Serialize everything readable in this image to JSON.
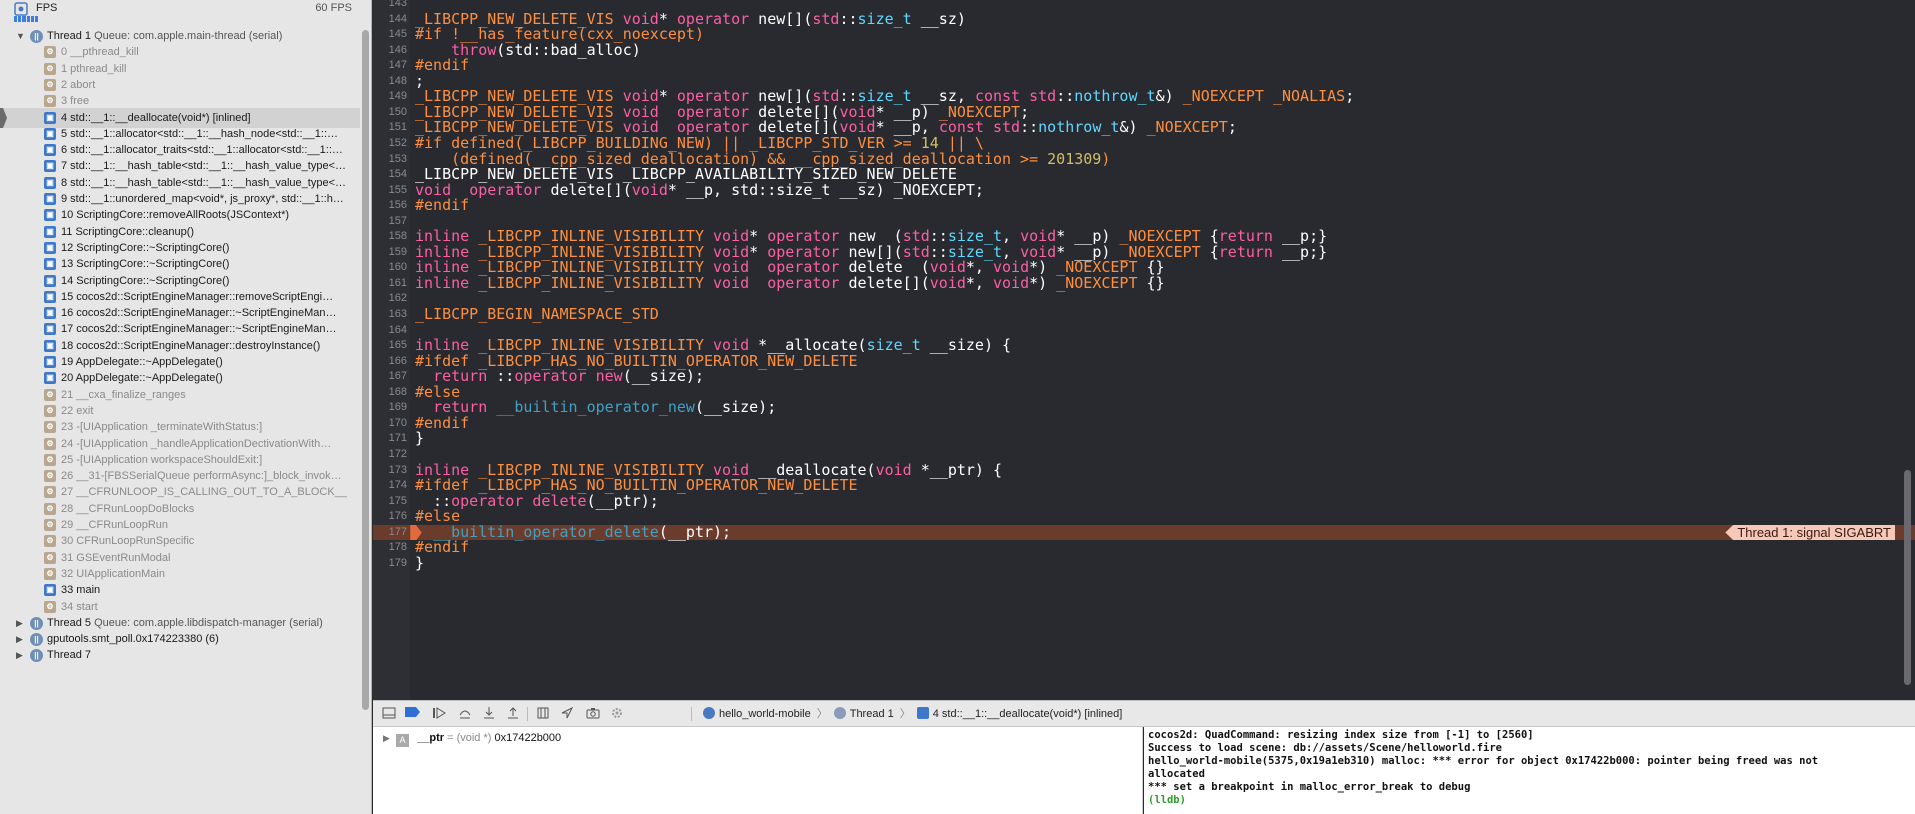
{
  "navigator": {
    "fps_label": "FPS",
    "fps_value": "60 FPS",
    "threads": [
      {
        "label": "Thread 1",
        "queue": "Queue: com.apple.main-thread (serial)"
      },
      {
        "label": "Thread 5",
        "queue": "Queue: com.apple.libdispatch-manager (serial)"
      },
      {
        "label": "gputools.smt_poll.0x174223380 (6)",
        "queue": ""
      },
      {
        "label": "Thread 7",
        "queue": ""
      }
    ],
    "frames": [
      {
        "text": "0 __pthread_kill",
        "user": false
      },
      {
        "text": "1 pthread_kill",
        "user": false
      },
      {
        "text": "2 abort",
        "user": false
      },
      {
        "text": "3 free",
        "user": false
      },
      {
        "text": "4 std::__1::__deallocate(void*) [inlined]",
        "user": true
      },
      {
        "text": "5 std::__1::allocator<std::__1::__hash_node<std::__1::…",
        "user": true
      },
      {
        "text": "6 std::__1::allocator_traits<std::__1::allocator<std::__1::…",
        "user": true
      },
      {
        "text": "7 std::__1::__hash_table<std::__1::__hash_value_type<v…",
        "user": true
      },
      {
        "text": "8 std::__1::__hash_table<std::__1::__hash_value_type<v…",
        "user": true
      },
      {
        "text": "9 std::__1::unordered_map<void*, js_proxy*, std::__1::h…",
        "user": true
      },
      {
        "text": "10 ScriptingCore::removeAllRoots(JSContext*)",
        "user": true
      },
      {
        "text": "11 ScriptingCore::cleanup()",
        "user": true
      },
      {
        "text": "12 ScriptingCore::~ScriptingCore()",
        "user": true
      },
      {
        "text": "13 ScriptingCore::~ScriptingCore()",
        "user": true
      },
      {
        "text": "14 ScriptingCore::~ScriptingCore()",
        "user": true
      },
      {
        "text": "15 cocos2d::ScriptEngineManager::removeScriptEngi…",
        "user": true
      },
      {
        "text": "16 cocos2d::ScriptEngineManager::~ScriptEngineMan…",
        "user": true
      },
      {
        "text": "17 cocos2d::ScriptEngineManager::~ScriptEngineMan…",
        "user": true
      },
      {
        "text": "18 cocos2d::ScriptEngineManager::destroyInstance()",
        "user": true
      },
      {
        "text": "19 AppDelegate::~AppDelegate()",
        "user": true
      },
      {
        "text": "20 AppDelegate::~AppDelegate()",
        "user": true
      },
      {
        "text": "21 __cxa_finalize_ranges",
        "user": false
      },
      {
        "text": "22 exit",
        "user": false
      },
      {
        "text": "23 -[UIApplication _terminateWithStatus:]",
        "user": false
      },
      {
        "text": "24 -[UIApplication _handleApplicationDectivationWith…",
        "user": false
      },
      {
        "text": "25 -[UIApplication workspaceShouldExit:]",
        "user": false
      },
      {
        "text": "26 __31-[FBSSerialQueue performAsync:]_block_invok…",
        "user": false
      },
      {
        "text": "27 __CFRUNLOOP_IS_CALLING_OUT_TO_A_BLOCK__",
        "user": false
      },
      {
        "text": "28 __CFRunLoopDoBlocks",
        "user": false
      },
      {
        "text": "29 __CFRunLoopRun",
        "user": false
      },
      {
        "text": "30 CFRunLoopRunSpecific",
        "user": false
      },
      {
        "text": "31 GSEventRunModal",
        "user": false
      },
      {
        "text": "32 UIApplicationMain",
        "user": false
      },
      {
        "text": "33 main",
        "user": true
      },
      {
        "text": "34 start",
        "user": false
      }
    ]
  },
  "editor": {
    "lines": [
      {
        "n": "143",
        "html": ""
      },
      {
        "n": "144",
        "html": "<span class='mc'>_LIBCPP_NEW_DELETE_VIS</span> <span class='kw'>void</span>* <span class='kw'>operator</span> new[](<span class='kw'>std</span>::<span class='ty'>size_t</span> __sz)"
      },
      {
        "n": "145",
        "html": "<span class='pp'>#if !__has_feature(cxx_noexcept)</span>"
      },
      {
        "n": "146",
        "html": "    <span class='kw'>throw</span>(std::bad_alloc)"
      },
      {
        "n": "147",
        "html": "<span class='pp'>#endif</span>"
      },
      {
        "n": "148",
        "html": ";"
      },
      {
        "n": "149",
        "html": "<span class='mc'>_LIBCPP_NEW_DELETE_VIS</span> <span class='kw'>void</span>* <span class='kw'>operator</span> new[](<span class='kw'>std</span>::<span class='ty'>size_t</span> __sz, <span class='kw'>const</span> <span class='kw'>std</span>::<span class='ty'>nothrow_t</span>&amp;) <span class='mc'>_NOEXCEPT</span> <span class='mc'>_NOALIAS</span>;"
      },
      {
        "n": "150",
        "html": "<span class='mc'>_LIBCPP_NEW_DELETE_VIS</span> <span class='kw'>void</span>  <span class='kw'>operator</span> delete[](<span class='kw'>void</span>* __p) <span class='mc'>_NOEXCEPT</span>;"
      },
      {
        "n": "151",
        "html": "<span class='mc'>_LIBCPP_NEW_DELETE_VIS</span> <span class='kw'>void</span>  <span class='kw'>operator</span> delete[](<span class='kw'>void</span>* __p, <span class='kw'>const</span> <span class='kw'>std</span>::<span class='ty'>nothrow_t</span>&amp;) <span class='mc'>_NOEXCEPT</span>;"
      },
      {
        "n": "152",
        "html": "<span class='pp'>#if defined(_LIBCPP_BUILDING_NEW) || _LIBCPP_STD_VER &gt;= </span><span class='num'>14</span><span class='pp'> || \\</span>"
      },
      {
        "n": "153",
        "html": "<span class='pp'>    (defined(__cpp_sized_deallocation) &amp;&amp; __cpp_sized_deallocation &gt;= </span><span class='num'>201309</span><span class='pp'>)</span>"
      },
      {
        "n": "154",
        "html": "_LIBCPP_NEW_DELETE_VIS _LIBCPP_AVAILABILITY_SIZED_NEW_DELETE"
      },
      {
        "n": "155",
        "html": "<span class='kw'>void</span>  <span class='kw'>operator</span> delete[](<span class='kw'>void</span>* __p, std::size_t __sz) _NOEXCEPT;"
      },
      {
        "n": "156",
        "html": "<span class='pp'>#endif</span>"
      },
      {
        "n": "157",
        "html": ""
      },
      {
        "n": "158",
        "html": "<span class='kw'>inline</span> <span class='mc'>_LIBCPP_INLINE_VISIBILITY</span> <span class='kw'>void</span>* <span class='kw'>operator</span> new  (<span class='kw'>std</span>::<span class='ty'>size_t</span>, <span class='kw'>void</span>* __p) <span class='mc'>_NOEXCEPT</span> {<span class='kw'>return</span> __p;}"
      },
      {
        "n": "159",
        "html": "<span class='kw'>inline</span> <span class='mc'>_LIBCPP_INLINE_VISIBILITY</span> <span class='kw'>void</span>* <span class='kw'>operator</span> new[](<span class='kw'>std</span>::<span class='ty'>size_t</span>, <span class='kw'>void</span>* __p) <span class='mc'>_NOEXCEPT</span> {<span class='kw'>return</span> __p;}"
      },
      {
        "n": "160",
        "html": "<span class='kw'>inline</span> <span class='mc'>_LIBCPP_INLINE_VISIBILITY</span> <span class='kw'>void</span>  <span class='kw'>operator</span> delete  (<span class='kw'>void</span>*, <span class='kw'>void</span>*) <span class='mc'>_NOEXCEPT</span> {}"
      },
      {
        "n": "161",
        "html": "<span class='kw'>inline</span> <span class='mc'>_LIBCPP_INLINE_VISIBILITY</span> <span class='kw'>void</span>  <span class='kw'>operator</span> delete[](<span class='kw'>void</span>*, <span class='kw'>void</span>*) <span class='mc'>_NOEXCEPT</span> {}"
      },
      {
        "n": "162",
        "html": ""
      },
      {
        "n": "163",
        "html": "<span class='mc'>_LIBCPP_BEGIN_NAMESPACE_STD</span>"
      },
      {
        "n": "164",
        "html": ""
      },
      {
        "n": "165",
        "html": "<span class='kw'>inline</span> <span class='mc'>_LIBCPP_INLINE_VISIBILITY</span> <span class='kw'>void</span> *__allocate(<span class='ty'>size_t</span> __size) {"
      },
      {
        "n": "166",
        "html": "<span class='pp'>#ifdef _LIBCPP_HAS_NO_BUILTIN_OPERATOR_NEW_DELETE</span>"
      },
      {
        "n": "167",
        "html": "  <span class='kw'>return</span> ::<span class='kw'>operator</span> <span class='kw'>new</span>(__size);"
      },
      {
        "n": "168",
        "html": "<span class='pp'>#else</span>"
      },
      {
        "n": "169",
        "html": "  <span class='kw'>return</span> <span class='fn'>__builtin_operator_new</span>(__size);"
      },
      {
        "n": "170",
        "html": "<span class='pp'>#endif</span>"
      },
      {
        "n": "171",
        "html": "}"
      },
      {
        "n": "172",
        "html": ""
      },
      {
        "n": "173",
        "html": "<span class='kw'>inline</span> <span class='mc'>_LIBCPP_INLINE_VISIBILITY</span> <span class='kw'>void</span> __deallocate(<span class='kw'>void</span> *__ptr) {"
      },
      {
        "n": "174",
        "html": "<span class='pp'>#ifdef _LIBCPP_HAS_NO_BUILTIN_OPERATOR_NEW_DELETE</span>"
      },
      {
        "n": "175",
        "html": "  ::<span class='kw'>operator</span> <span class='kw'>delete</span>(__ptr);"
      },
      {
        "n": "176",
        "html": "<span class='pp'>#else</span>"
      },
      {
        "n": "177",
        "html": "  <span class='fn'>__builtin_operator_delete</span>(__ptr);"
      },
      {
        "n": "178",
        "html": "<span class='pp'>#endif</span>"
      },
      {
        "n": "179",
        "html": "}"
      }
    ],
    "signal_badge": "Thread 1: signal SIGABRT"
  },
  "debug_bar": {
    "breadcrumbs": [
      "hello_world-mobile",
      "Thread 1",
      "4 std::__1::__deallocate(void*) [inlined]"
    ]
  },
  "variables": {
    "name": "__ptr",
    "type": "= (void *)",
    "value": "0x17422b000",
    "type_icon_letter": "A"
  },
  "console": {
    "lines": [
      "cocos2d: QuadCommand: resizing index size from [-1] to [2560]",
      "Success to load scene: db://assets/Scene/helloworld.fire",
      "hello_world-mobile(5375,0x19a1eb310) malloc: *** error for object 0x17422b000: pointer being freed was not",
      "allocated",
      "*** set a breakpoint in malloc_error_break to debug",
      "(lldb)"
    ]
  },
  "colors": {
    "editor_bg": "#292a30",
    "current_line": "#6b3b2c",
    "keyword": "#fc5fa3",
    "preprocessor": "#fd8f3f",
    "type": "#5dd8ff",
    "accent": "#3e78c8"
  }
}
